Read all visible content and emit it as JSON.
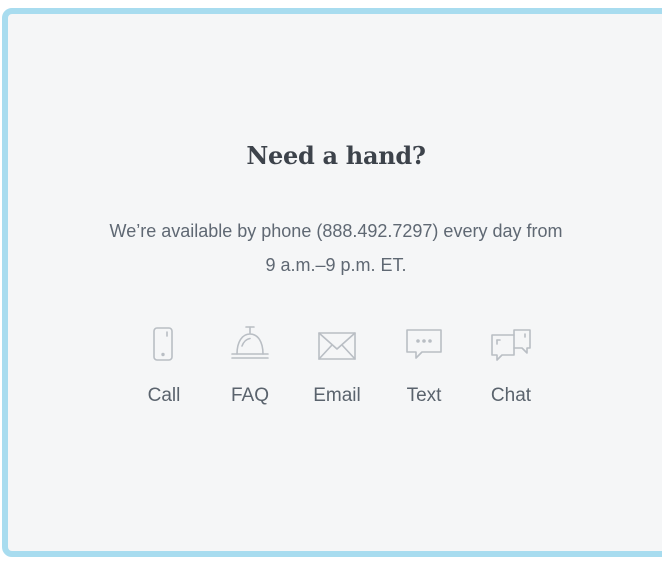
{
  "help": {
    "title": "Need a hand?",
    "desc_line1": "We’re available by phone (888.492.7297) every day from",
    "desc_line2": "9 a.m.–9 p.m. ET."
  },
  "options": [
    {
      "label": "Call",
      "icon": "phone-icon"
    },
    {
      "label": "FAQ",
      "icon": "service-bell-icon"
    },
    {
      "label": "Email",
      "icon": "envelope-icon"
    },
    {
      "label": "Text",
      "icon": "text-bubble-icon"
    },
    {
      "label": "Chat",
      "icon": "chat-bubbles-icon"
    }
  ],
  "colors": {
    "border": "#a8dcef",
    "card_background": "#f5f6f7",
    "title": "#3d434b",
    "body_text": "#5f6873",
    "icon_stroke": "#b9bec4"
  }
}
